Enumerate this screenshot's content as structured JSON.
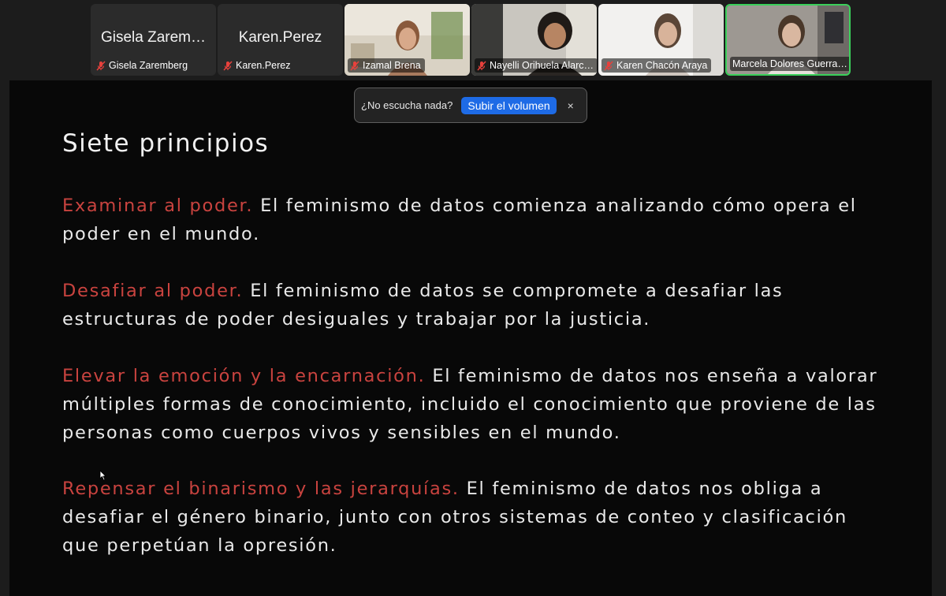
{
  "participants": [
    {
      "display": "Gisela Zarem…",
      "name": "Gisela Zaremberg",
      "video": false
    },
    {
      "display": "Karen.Perez",
      "name": "Karen.Perez",
      "video": false
    },
    {
      "name": "Izamal Brena",
      "video": true
    },
    {
      "name": "Nayelli Orihuela Alarc…",
      "video": true
    },
    {
      "name": "Karen Chacón Araya",
      "video": true
    },
    {
      "name": "Marcela Dolores Guerra…",
      "video": true,
      "active": true
    }
  ],
  "audio_toast": {
    "message": "¿No escucha nada?",
    "button": "Subir el volumen",
    "close": "×"
  },
  "slide": {
    "title": "Siete principios",
    "principles": [
      {
        "lead": "Examinar al poder.",
        "text": " El feminismo de datos comienza analizando cómo opera el poder en el mundo."
      },
      {
        "lead": "Desafiar al poder.",
        "text": " El feminismo de datos se compromete a desafiar las estructuras de poder desiguales y trabajar por la justicia."
      },
      {
        "lead": "Elevar la emoción y la encarnación.",
        "text": " El feminismo de datos nos enseña a valorar múltiples formas de conocimiento, incluido el conocimiento que proviene de las personas como cuerpos vivos y sensibles en el mundo."
      },
      {
        "lead": "Repensar el binarismo y las jerarquías.",
        "text": " El feminismo de datos nos obliga a desafiar el género binario, junto con otros sistemas de conteo y clasificación que perpetúan la opresión."
      }
    ]
  },
  "colors": {
    "accent_red": "#c9433f",
    "active_speaker": "#3ad05a",
    "button_blue": "#1e6be6"
  }
}
